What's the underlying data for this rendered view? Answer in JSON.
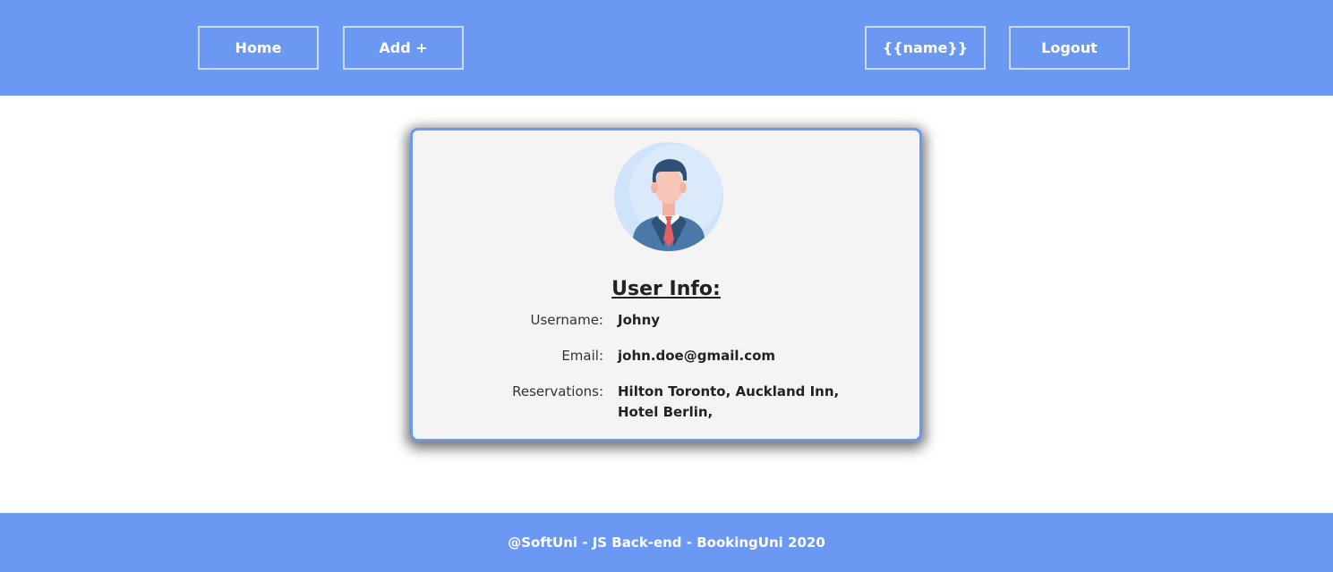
{
  "nav": {
    "home_label": "Home",
    "add_label": "Add +",
    "user_label": "{{name}}",
    "logout_label": "Logout"
  },
  "user_card": {
    "title": "User Info:",
    "avatar_icon": "businessman-avatar-icon",
    "fields": [
      {
        "label": "Username:",
        "value": "Johny"
      },
      {
        "label": "Email:",
        "value": "john.doe@gmail.com"
      },
      {
        "label": "Reservations:",
        "value": "Hilton Toronto, Auckland Inn, Hotel Berlin,"
      }
    ]
  },
  "footer": {
    "text": "@SoftUni - JS Back-end - BookingUni 2020"
  },
  "colors": {
    "primary": "#6b98f2",
    "card_background": "#f4f4f4",
    "avatar_circle": "#cfe3fb",
    "suit": "#4a79a8",
    "tie": "#e0606a",
    "hair": "#2e5275",
    "skin": "#f7c6b7"
  }
}
